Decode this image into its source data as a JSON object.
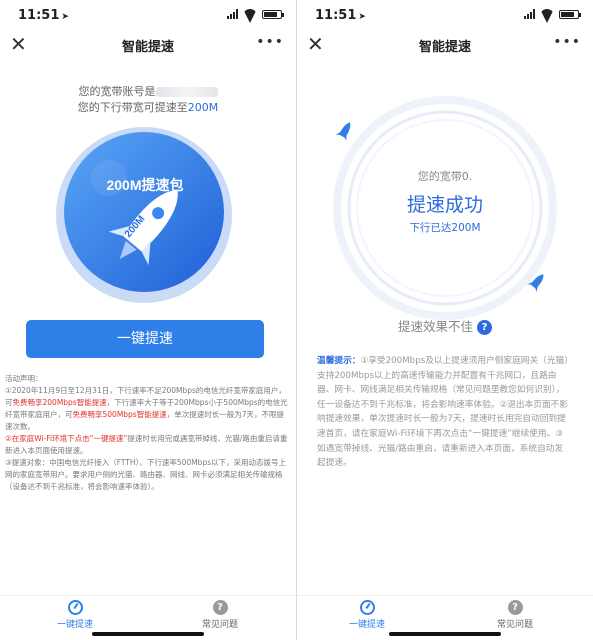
{
  "status": {
    "time": "11:51",
    "location_icon": "location-arrow-icon"
  },
  "nav": {
    "title": "智能提速",
    "close_icon": "close-icon",
    "more_icon": "more-icon",
    "close": "✕",
    "more": "•••"
  },
  "left": {
    "account_prefix": "您的宽带账号是",
    "speed_prefix": "您的下行带宽可提速至",
    "speed_value": "200M",
    "badge_label": "200M提速包",
    "rocket_label": "200M",
    "button_label": "一键提速",
    "rules": {
      "heading": "活动声明：",
      "p1_a": "①2020年11月9日至12月31日，下行速率不足200Mbps的电信光纤宽带家庭用户，可",
      "p1_red1": "免费畅享200Mbps智能提速",
      "p1_b": "，下行速率大于等于200Mbps小于500Mbps的电信光纤宽带家庭用户，可",
      "p1_red2": "免费畅享500Mbps智能提速",
      "p1_c": "，单次提速时长一般为7天，不限提速次数。",
      "p2_a": "②",
      "p2_red": "在家庭Wi-Fi环境下点击“一键提速”",
      "p2_b": "提速时长用完或遇宽带掉线、光猫/路由重启请重新进入本页面使用提速。",
      "p3": "③提速对象：中国电信光纤接入（FTTH）、下行速率500Mbps以下，采用动态拨号上网的家庭宽带用户。要求用户侧的光猫、路由器、网线、网卡必须满足相关传输规格（设备达不到千兆标准，将会影响速率体验）。"
    }
  },
  "right": {
    "account_prefix": "您的宽带0.",
    "success_title": "提速成功",
    "success_sub": "下行已达200M",
    "bad_label": "提速效果不佳",
    "help_icon": "?",
    "tips_lead": "温馨提示：",
    "tips_text": "①享受200Mbps及以上提速须用户侧家庭网关（光猫）支持200Mbps以上的高速传输能力并配置有千兆网口，且路由器、网卡、网线满足相关传输规格（常见问题里教您如何识别），任一设备达不到千兆标准，将会影响速率体验。②退出本页面不影响提速效果，单次提速时长一般为7天，提速时长用完自动回到提速首页，请在家庭Wi-Fi环境下再次点击“一键提速”继续使用。③如遇宽带掉线、光猫/路由重启，请重新进入本页面，系统自动发起提速。"
  },
  "tabs": [
    {
      "label": "一键提速",
      "icon": "speedometer-icon"
    },
    {
      "label": "常见问题",
      "icon": "question-icon",
      "glyph": "?"
    }
  ],
  "colors": {
    "accent": "#2f7fe8",
    "red": "#e0312c"
  }
}
